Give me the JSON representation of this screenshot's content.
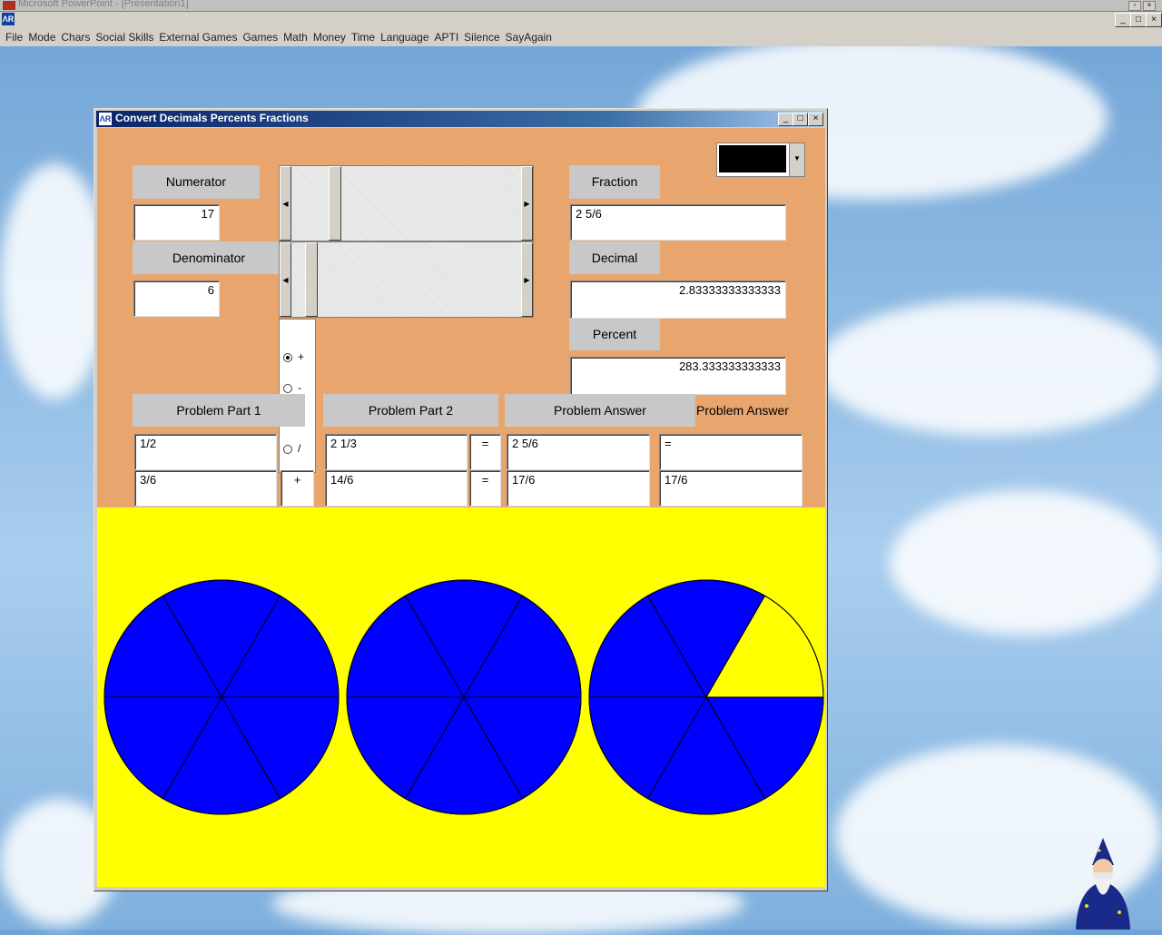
{
  "desktop": {
    "powerpoint_title": "Microsoft PowerPoint - [Presentation1]"
  },
  "menu": [
    "File",
    "Mode",
    "Chars",
    "Social Skills",
    "External Games",
    "Games",
    "Math",
    "Money",
    "Time",
    "Language",
    "APTI",
    "Silence",
    "SayAgain"
  ],
  "window": {
    "title": "Convert Decimals Percents Fractions",
    "numerator_label": "Numerator",
    "numerator_value": "17",
    "denominator_label": "Denominator",
    "denominator_value": "6",
    "fraction_label": "Fraction",
    "fraction_value": "2 5/6",
    "decimal_label": "Decimal",
    "decimal_value": "2.83333333333333",
    "percent_label": "Percent",
    "percent_value": "283.333333333333",
    "color_swatch": "#000000",
    "operations": [
      {
        "symbol": "+",
        "selected": true
      },
      {
        "symbol": "-",
        "selected": false
      },
      {
        "symbol": "×",
        "selected": false
      },
      {
        "symbol": "/",
        "selected": false
      }
    ],
    "problem_headers": [
      "Problem Part 1",
      "Problem Part 2",
      "Problem Answer",
      "Problem Answer"
    ],
    "row1": {
      "part1": "1/2",
      "part2": "2 1/3",
      "eq": "=",
      "answer": "2 5/6",
      "answer2": "="
    },
    "row2": {
      "part1": "3/6",
      "op": "+",
      "part2": "14/6",
      "eq": "=",
      "answer": "17/6",
      "answer2": "17/6"
    }
  },
  "pies": [
    {
      "denominator": 6,
      "filled": 6
    },
    {
      "denominator": 6,
      "filled": 6
    },
    {
      "denominator": 6,
      "filled": 5
    }
  ],
  "colors": {
    "pie_fill": "#0000ff",
    "canvas_bg": "#ffff00",
    "panel_bg": "#e8a56e"
  }
}
